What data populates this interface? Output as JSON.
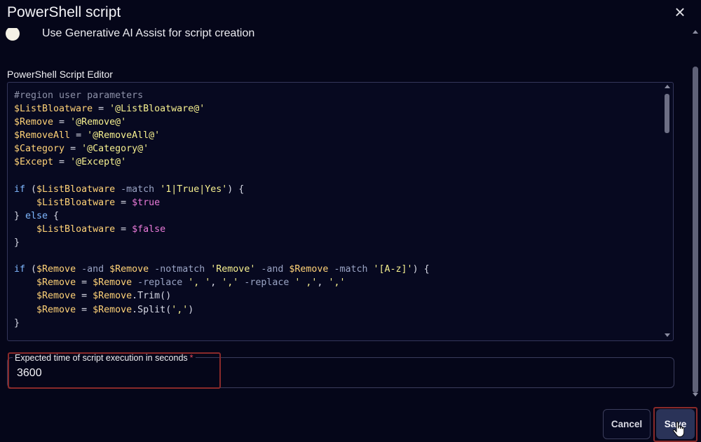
{
  "dialog": {
    "title": "PowerShell script",
    "close_icon": "close-icon"
  },
  "ai_assist": {
    "label": "Use Generative AI Assist for script creation",
    "enabled": false
  },
  "editor": {
    "label": "PowerShell Script Editor",
    "lines": [
      "#region user parameters",
      "$ListBloatware = '@ListBloatware@'",
      "$Remove = '@Remove@'",
      "$RemoveAll = '@RemoveAll@'",
      "$Category = '@Category@'",
      "$Except = '@Except@'",
      "",
      "if ($ListBloatware -match '1|True|Yes') {",
      "    $ListBloatware = $true",
      "} else {",
      "    $ListBloatware = $false",
      "}",
      "",
      "if ($Remove -and $Remove -notmatch 'Remove' -and $Remove -match '[A-z]') {",
      "    $Remove = $Remove -replace ', ', ',' -replace ' ,', ','",
      "    $Remove = $Remove.Trim()",
      "    $Remove = $Remove.Split(',')",
      "}"
    ]
  },
  "execution_time": {
    "label": "Expected time of script execution in seconds",
    "required_mark": "*",
    "value": "3600"
  },
  "buttons": {
    "cancel": "Cancel",
    "save": "Save"
  },
  "colors": {
    "background": "#050619",
    "primary_button": "#2a3358",
    "highlight": "#8a2a2a",
    "required": "#e0485a"
  }
}
